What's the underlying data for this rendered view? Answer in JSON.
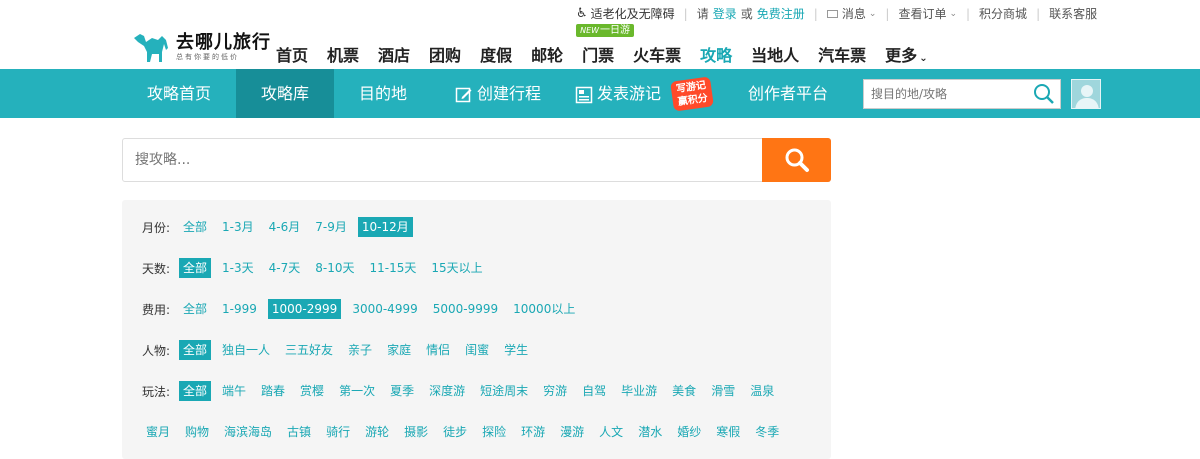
{
  "topbar": {
    "accessibility": "适老化及无障碍",
    "please": "请",
    "login": "登录",
    "or": "或",
    "register": "免费注册",
    "messages": "消息",
    "orders": "查看订单",
    "points_mall": "积分商城",
    "contact": "联系客服"
  },
  "logo": {
    "title": "去哪儿旅行",
    "subtitle": "总有你要的低价"
  },
  "mainnav": {
    "items": [
      "首页",
      "机票",
      "酒店",
      "团购",
      "度假",
      "邮轮",
      "门票",
      "火车票",
      "攻略",
      "当地人",
      "汽车票",
      "更多"
    ],
    "new_badge_prefix": "NEW",
    "new_badge_text": "一日游",
    "active": "攻略"
  },
  "subnav": {
    "items": [
      "攻略首页",
      "攻略库",
      "目的地",
      "创建行程",
      "发表游记",
      "创作者平台"
    ],
    "active": "攻略库",
    "promo_line1": "写游记",
    "promo_line2": "赢积分",
    "search_placeholder": "搜目的地/攻略"
  },
  "search": {
    "placeholder": "搜攻略..."
  },
  "colors": {
    "teal": "#25b1bc",
    "teal_dark": "#178e98",
    "orange": "#ff7514",
    "link": "#1aa8b4"
  },
  "filters": {
    "month": {
      "label": "月份:",
      "options": [
        "全部",
        "1-3月",
        "4-6月",
        "7-9月",
        "10-12月"
      ],
      "selected": "10-12月"
    },
    "days": {
      "label": "天数:",
      "options": [
        "全部",
        "1-3天",
        "4-7天",
        "8-10天",
        "11-15天",
        "15天以上"
      ],
      "selected": "全部"
    },
    "cost": {
      "label": "费用:",
      "options": [
        "全部",
        "1-999",
        "1000-2999",
        "3000-4999",
        "5000-9999",
        "10000以上"
      ],
      "selected": "1000-2999"
    },
    "people": {
      "label": "人物:",
      "options": [
        "全部",
        "独自一人",
        "三五好友",
        "亲子",
        "家庭",
        "情侣",
        "闺蜜",
        "学生"
      ],
      "selected": "全部"
    },
    "play": {
      "label": "玩法:",
      "options": [
        "全部",
        "端午",
        "踏春",
        "赏樱",
        "第一次",
        "夏季",
        "深度游",
        "短途周末",
        "穷游",
        "自驾",
        "毕业游",
        "美食",
        "滑雪",
        "温泉"
      ],
      "selected": "全部"
    },
    "play2": {
      "options": [
        "蜜月",
        "购物",
        "海滨海岛",
        "古镇",
        "骑行",
        "游轮",
        "摄影",
        "徒步",
        "探险",
        "环游",
        "漫游",
        "人文",
        "潜水",
        "婚纱",
        "寒假",
        "冬季"
      ]
    }
  }
}
